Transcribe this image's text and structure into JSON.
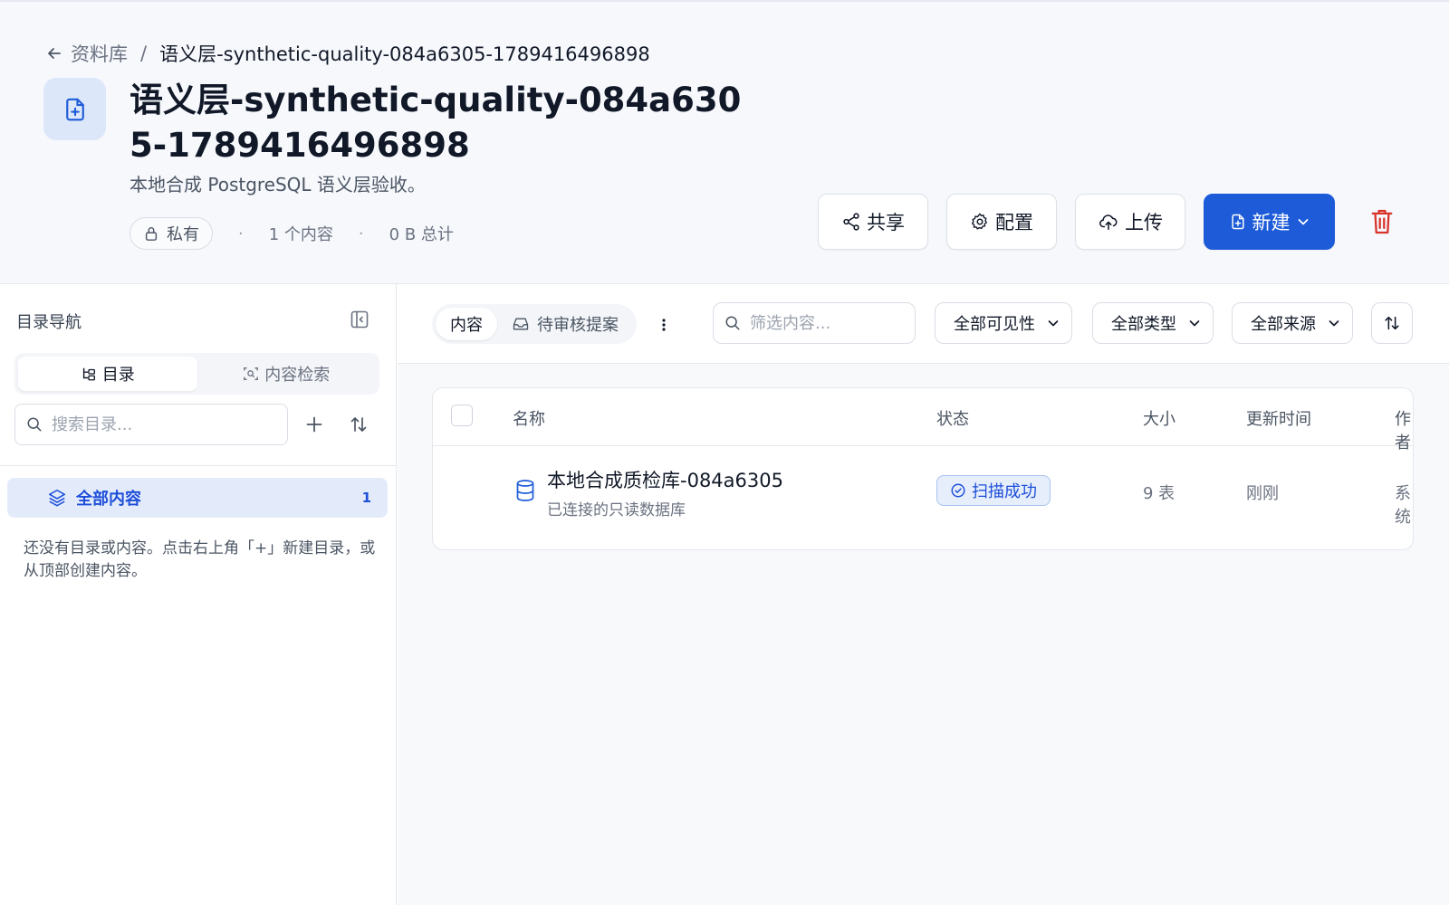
{
  "breadcrumb": {
    "parent": "资料库",
    "separator": "/",
    "current": "语义层-synthetic-quality-084a6305-1789416496898"
  },
  "page": {
    "title": "语义层-synthetic-quality-084a6305-1789416496898",
    "description": "本地合成 PostgreSQL 语义层验收。",
    "visibility": "私有",
    "item_count": "1 个内容",
    "total_size": "0 B 总计",
    "meta_separator": "·"
  },
  "actions": {
    "share": "共享",
    "config": "配置",
    "upload": "上传",
    "new": "新建"
  },
  "sidebar": {
    "title": "目录导航",
    "tabs": [
      {
        "label": "目录",
        "active": true
      },
      {
        "label": "内容检索",
        "active": false
      }
    ],
    "search_placeholder": "搜索目录...",
    "tree": {
      "all_label": "全部内容",
      "all_count": "1"
    },
    "empty_hint": "还没有目录或内容。点击右上角「+」新建目录，或从顶部创建内容。"
  },
  "toolbar": {
    "tabs": [
      {
        "label": "内容",
        "active": true
      },
      {
        "label": "待审核提案",
        "active": false
      }
    ],
    "filter_placeholder": "筛选内容...",
    "visibility_select": "全部可见性",
    "type_select": "全部类型",
    "source_select": "全部来源"
  },
  "table": {
    "columns": {
      "name": "名称",
      "status": "状态",
      "size": "大小",
      "updated": "更新时间",
      "author": "作者"
    },
    "rows": [
      {
        "name": "本地合成质检库-084a6305",
        "subtitle": "已连接的只读数据库",
        "status": "扫描成功",
        "size": "9 表",
        "updated": "刚刚",
        "author": "系统"
      }
    ]
  },
  "colors": {
    "primary": "#1d5bd8",
    "danger": "#d9342b",
    "header_bg": "#f6f8fc",
    "status_bg": "#e6eefc"
  }
}
